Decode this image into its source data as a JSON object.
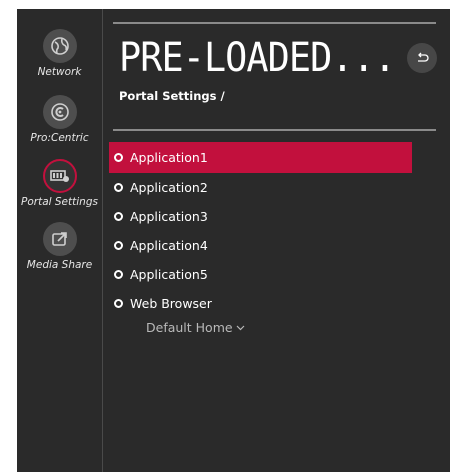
{
  "sidebar": {
    "items": [
      {
        "label": "Network",
        "icon": "globe-icon"
      },
      {
        "label": "Pro:Centric",
        "icon": "procentric-icon"
      },
      {
        "label": "Portal Settings",
        "icon": "portal-settings-icon"
      },
      {
        "label": "Media Share",
        "icon": "media-share-icon"
      }
    ],
    "active_index": 2
  },
  "header": {
    "title": "PRE-LOADED...",
    "breadcrumb": "Portal Settings /"
  },
  "menu": {
    "items": [
      {
        "label": "Application1",
        "selected": true
      },
      {
        "label": "Application2",
        "selected": false
      },
      {
        "label": "Application3",
        "selected": false
      },
      {
        "label": "Application4",
        "selected": false
      },
      {
        "label": "Application5",
        "selected": false
      },
      {
        "label": "Web Browser",
        "selected": false
      }
    ],
    "default_home_label": "Default Home"
  },
  "colors": {
    "accent": "#c2103d",
    "background": "#2a2a2a"
  }
}
